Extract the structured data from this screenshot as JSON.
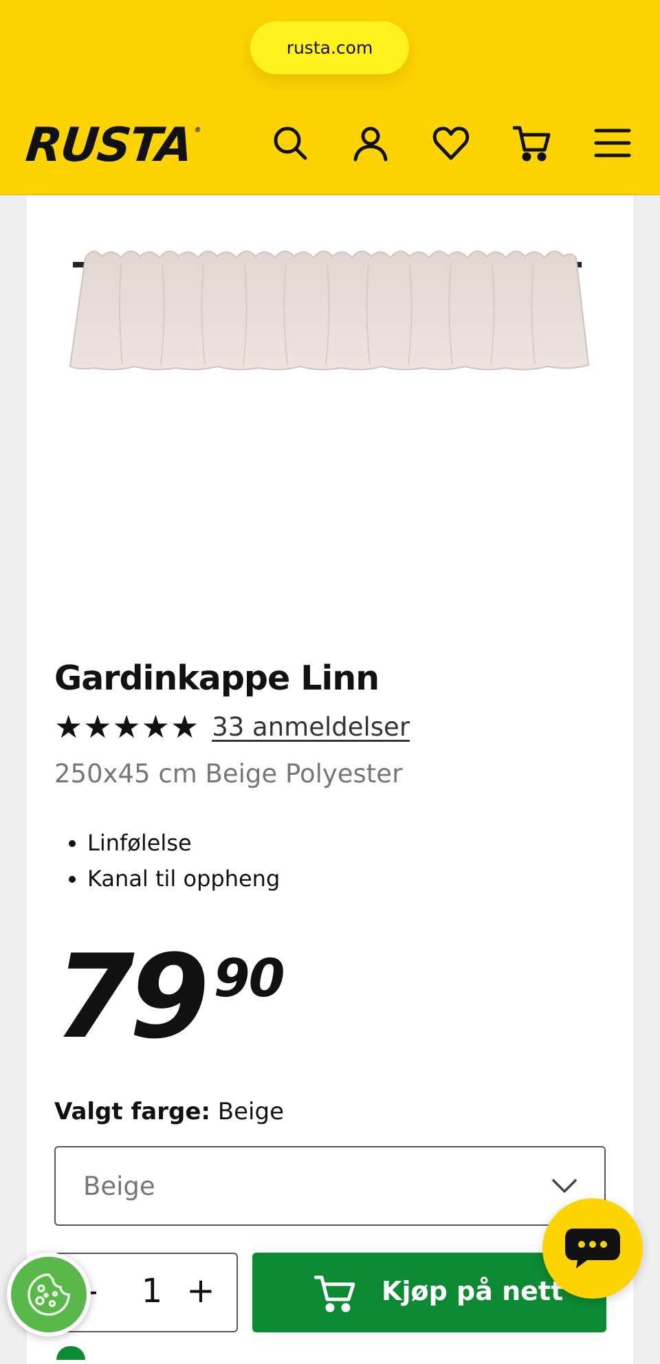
{
  "browser": {
    "url": "rusta.com"
  },
  "header": {
    "logo": "RUSTA",
    "logo_mark": "®",
    "icons": [
      "search-icon",
      "account-icon",
      "wishlist-heart-icon",
      "cart-icon",
      "menu-hamburger-icon"
    ]
  },
  "product": {
    "title": "Gardinkappe Linn",
    "stars": "★★★★★",
    "rating_out_of_5": 5,
    "reviews_link": "33 anmeldelser",
    "subtitle": "250x45 cm Beige Polyester",
    "features": [
      "Linfølelse",
      "Kanal til oppheng"
    ],
    "price_main": "79",
    "price_decimals": "90",
    "colors": {
      "brand_yellow": "#fed400",
      "buy_green": "#0c8a33"
    }
  },
  "color_select": {
    "label_prefix": "Valgt farge:",
    "label_value": "Beige",
    "selected": "Beige"
  },
  "quantity": {
    "minus": "-",
    "value": "1",
    "plus": "+"
  },
  "buy_button": {
    "label": "Kjøp på nett"
  },
  "floating": {
    "chat": "chat-bubble-icon",
    "cookie": "cookie-icon"
  }
}
